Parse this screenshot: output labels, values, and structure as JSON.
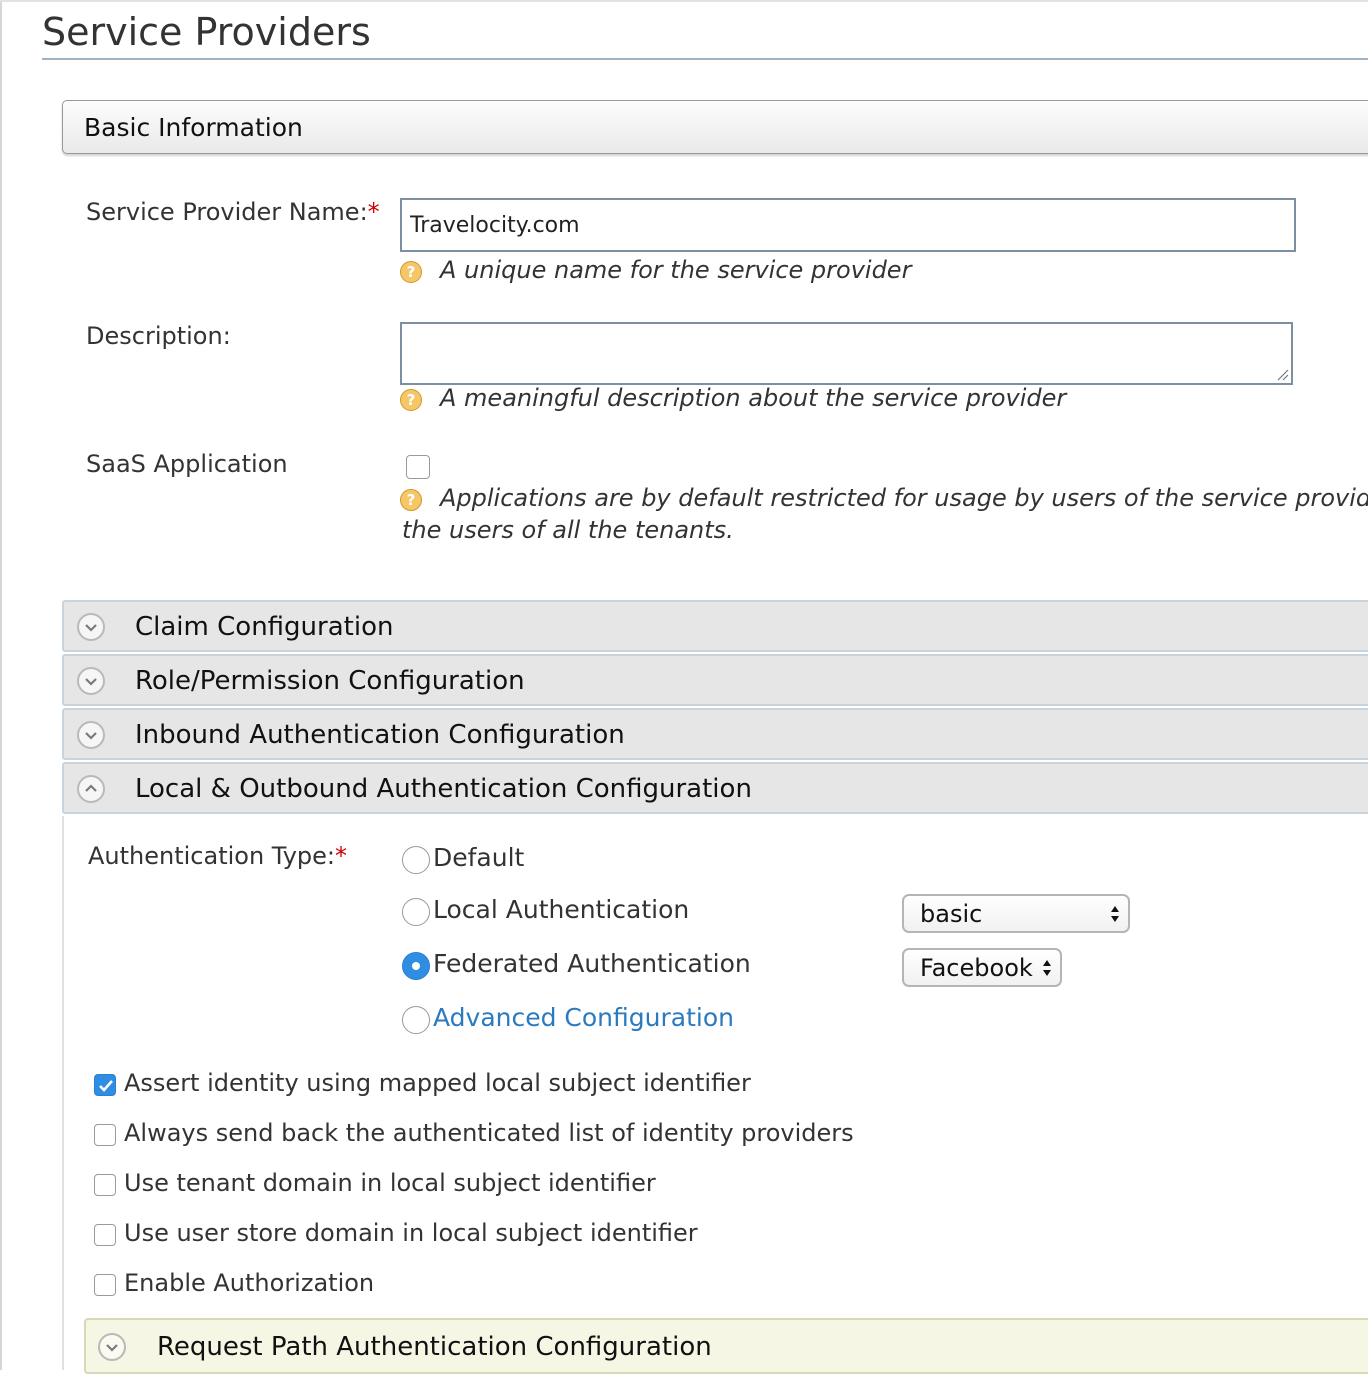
{
  "page": {
    "title": "Service Providers"
  },
  "basic_info": {
    "header": "Basic Information",
    "name": {
      "label": "Service Provider Name:",
      "required_mark": "*",
      "value": "Travelocity.com",
      "help": "A unique name for the service provider"
    },
    "description": {
      "label": "Description:",
      "value": "",
      "help": "A meaningful description about the service provider"
    },
    "saas": {
      "label": "SaaS Application",
      "checked": false,
      "help_line1": "Applications are by default restricted for usage by users of the service provider'",
      "help_line2": "the users of all the tenants."
    }
  },
  "sections": [
    {
      "title": "Claim Configuration",
      "expanded": false
    },
    {
      "title": "Role/Permission Configuration",
      "expanded": false
    },
    {
      "title": "Inbound Authentication Configuration",
      "expanded": false
    },
    {
      "title": "Local & Outbound Authentication Configuration",
      "expanded": true
    }
  ],
  "auth": {
    "type_label": "Authentication Type:",
    "required_mark": "*",
    "options": [
      {
        "label": "Default",
        "selected": false
      },
      {
        "label": "Local Authentication",
        "selected": false,
        "select_value": "basic"
      },
      {
        "label": "Federated Authentication",
        "selected": true,
        "select_value": "Facebook"
      },
      {
        "label": "Advanced Configuration",
        "selected": false,
        "is_link": true
      }
    ],
    "checkboxes": [
      {
        "label": "Assert identity using mapped local subject identifier",
        "checked": true
      },
      {
        "label": "Always send back the authenticated list of identity providers",
        "checked": false
      },
      {
        "label": "Use tenant domain in local subject identifier",
        "checked": false
      },
      {
        "label": "Use user store domain in local subject identifier",
        "checked": false
      },
      {
        "label": "Enable Authorization",
        "checked": false
      }
    ],
    "request_path": {
      "title": "Request Path Authentication Configuration",
      "expanded": false
    }
  },
  "colors": {
    "accent": "#2f8de4",
    "link": "#2a7ac0",
    "required": "#cc0000",
    "help_icon": "#f5c768"
  },
  "icons": {
    "help": "help-icon",
    "collapsed": "chevron-down-icon",
    "expanded": "chevron-up-icon"
  }
}
